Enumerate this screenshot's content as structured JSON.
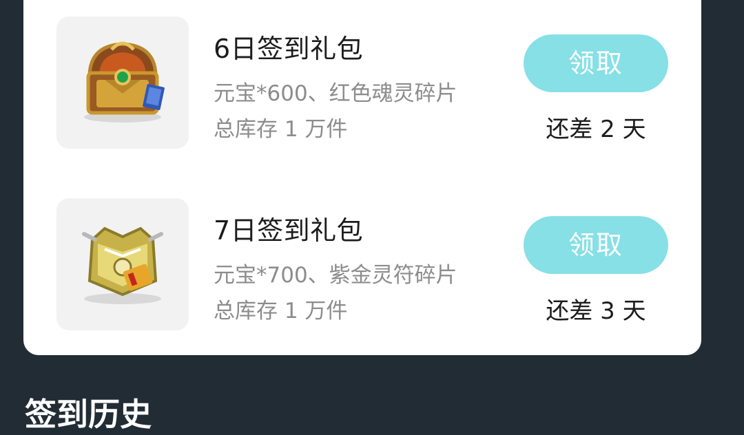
{
  "gifts": [
    {
      "title": "6日签到礼包",
      "description": "元宝*600、红色魂灵碎片",
      "stock": "总库存 1 万件",
      "button_label": "领取",
      "remaining": "还差 2 天",
      "icon": "treasure-chest-icon"
    },
    {
      "title": "7日签到礼包",
      "description": "元宝*700、紫金灵符碎片",
      "stock": "总库存 1 万件",
      "button_label": "领取",
      "remaining": "还差 3 天",
      "icon": "golden-chest-icon"
    }
  ],
  "history": {
    "title": "签到历史"
  },
  "colors": {
    "background": "#222c35",
    "card": "#ffffff",
    "button": "#86e0e6",
    "muted_text": "#8c8c8c"
  }
}
